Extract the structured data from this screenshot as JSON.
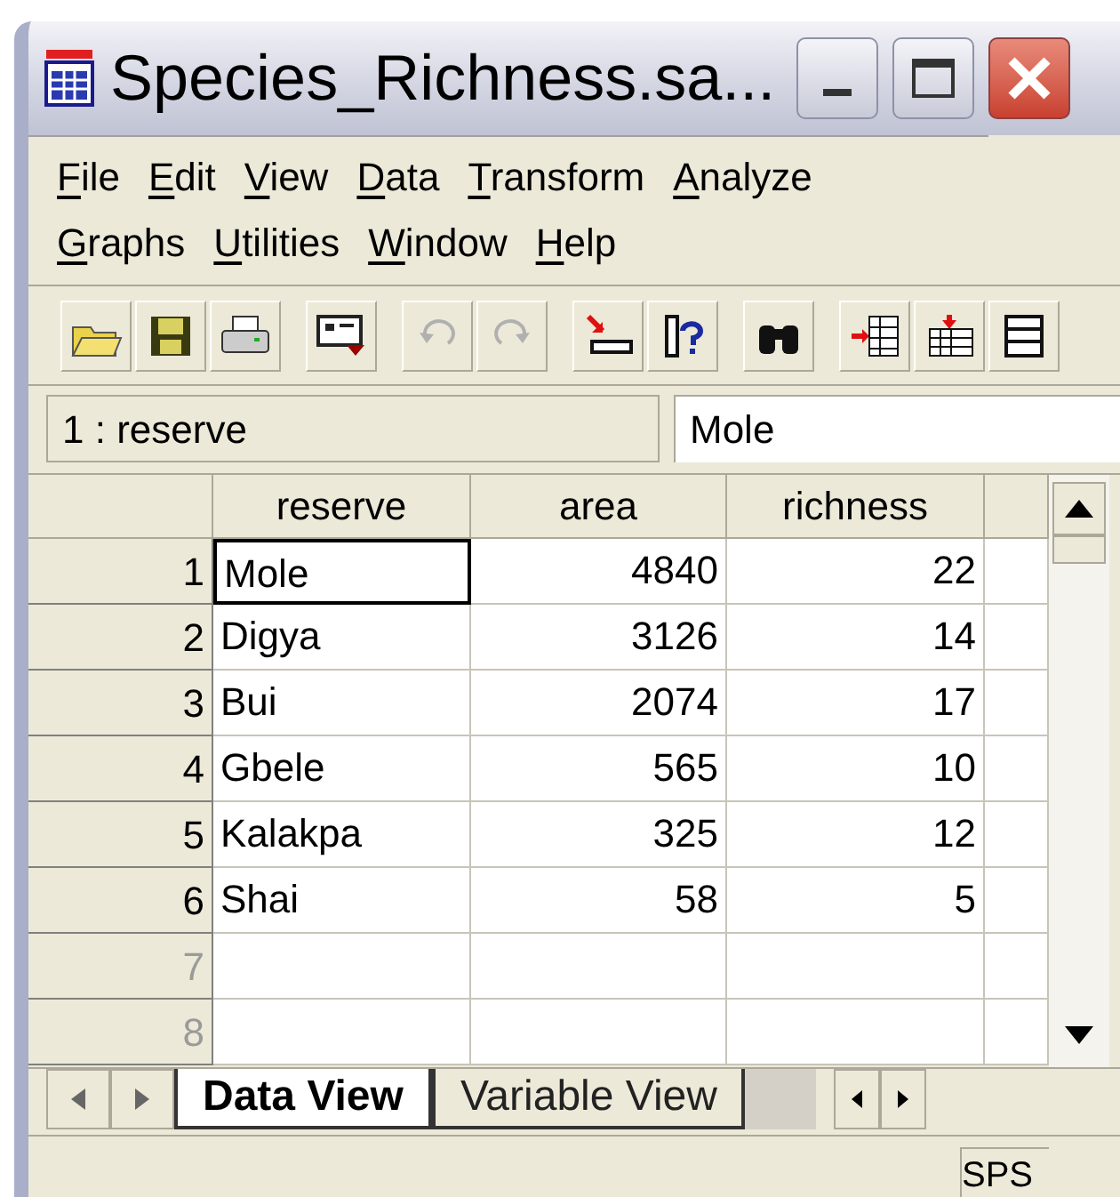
{
  "window": {
    "title": "Species_Richness.sa..."
  },
  "menu": [
    {
      "label": "File"
    },
    {
      "label": "Edit"
    },
    {
      "label": "View"
    },
    {
      "label": "Data"
    },
    {
      "label": "Transform"
    },
    {
      "label": "Analyze"
    },
    {
      "label": "Graphs"
    },
    {
      "label": "Utilities"
    },
    {
      "label": "Window"
    },
    {
      "label": "Help"
    }
  ],
  "cell_editor": {
    "location": "1 : reserve",
    "value": "Mole"
  },
  "table": {
    "columns": [
      "reserve",
      "area",
      "richness"
    ],
    "rows": [
      {
        "number": "1",
        "cells": [
          {
            "text": "Mole",
            "selected": true
          },
          {
            "text": "4840",
            "selected": false
          },
          {
            "text": "22",
            "selected": false
          }
        ]
      },
      {
        "number": "2",
        "cells": [
          {
            "text": "Digya",
            "selected": false
          },
          {
            "text": "3126",
            "selected": false
          },
          {
            "text": "14",
            "selected": false
          }
        ]
      },
      {
        "number": "3",
        "cells": [
          {
            "text": "Bui",
            "selected": false
          },
          {
            "text": "2074",
            "selected": false
          },
          {
            "text": "17",
            "selected": false
          }
        ]
      },
      {
        "number": "4",
        "cells": [
          {
            "text": "Gbele",
            "selected": false
          },
          {
            "text": "565",
            "selected": false
          },
          {
            "text": "10",
            "selected": false
          }
        ]
      },
      {
        "number": "5",
        "cells": [
          {
            "text": "Kalakpa",
            "selected": false
          },
          {
            "text": "325",
            "selected": false
          },
          {
            "text": "12",
            "selected": false
          }
        ]
      },
      {
        "number": "6",
        "cells": [
          {
            "text": "Shai",
            "selected": false
          },
          {
            "text": "58",
            "selected": false
          },
          {
            "text": "5",
            "selected": false
          }
        ]
      },
      {
        "number": "7",
        "cells": []
      },
      {
        "number": "8",
        "cells": []
      }
    ]
  },
  "tabs": [
    {
      "label": "Data View",
      "selected": true
    },
    {
      "label": "Variable View",
      "selected": false
    }
  ],
  "status_bar": {
    "text": "SPS"
  }
}
